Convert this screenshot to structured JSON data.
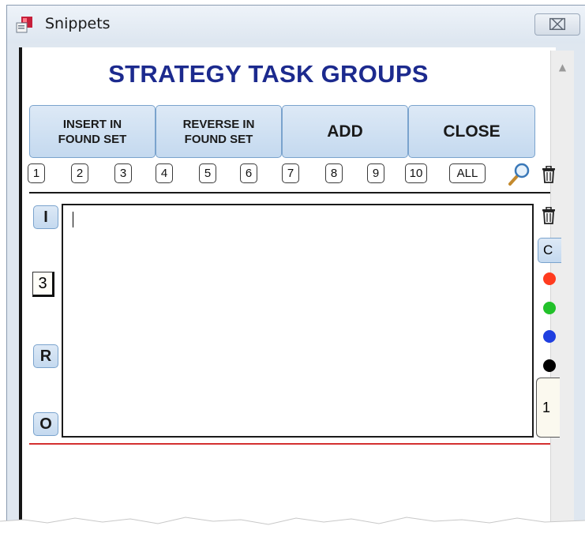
{
  "window": {
    "title": "Snippets",
    "close_glyph": "⌧"
  },
  "header": {
    "title": "STRATEGY TASK GROUPS"
  },
  "toolbar": {
    "insert_line1": "INSERT IN",
    "insert_line2": "FOUND SET",
    "reverse_line1": "REVERSE IN",
    "reverse_line2": "FOUND SET",
    "add": "ADD",
    "close": "CLOSE"
  },
  "groups": [
    "1",
    "2",
    "3",
    "4",
    "5",
    "6",
    "7",
    "8",
    "9",
    "10",
    "ALL"
  ],
  "side": {
    "i_label": "I",
    "count": "3",
    "r_label": "R",
    "o_label": "O",
    "c_label": "C",
    "num_label": "1"
  },
  "editor": {
    "value": ""
  },
  "colors": {
    "title_blue": "#1c2a8e",
    "button_blue": "#c4d9ef",
    "dot_red": "#ff3b1f",
    "dot_green": "#22c12a",
    "dot_blue": "#1f3fe0",
    "dot_black": "#000000",
    "divider_red": "#d43030"
  },
  "icons": [
    "app-icon",
    "close-icon",
    "search-icon",
    "trash-icon",
    "scroll-up-icon"
  ]
}
